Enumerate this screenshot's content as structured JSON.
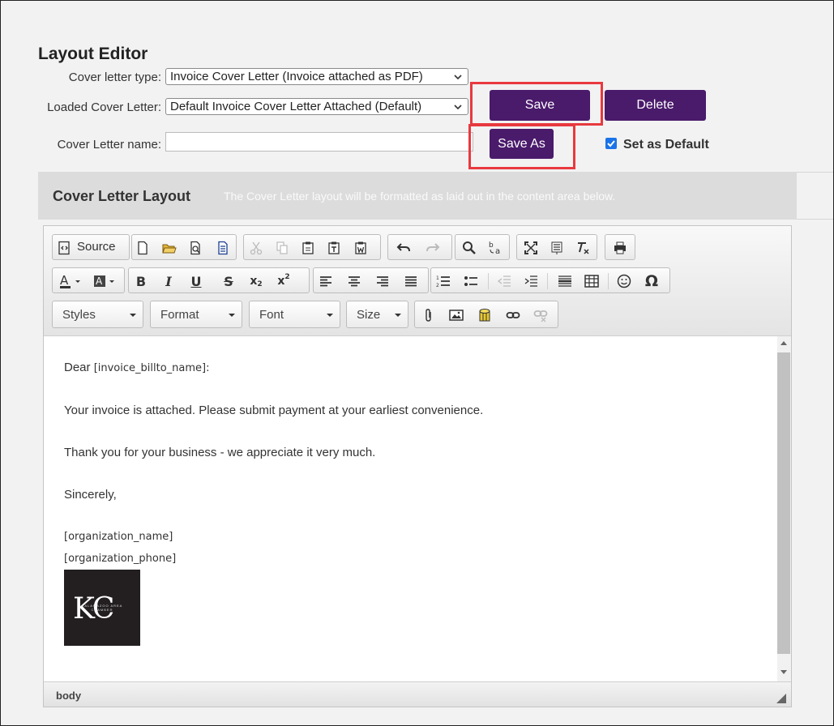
{
  "page": {
    "title": "Layout Editor",
    "cover_letter_type_label": "Cover letter type:",
    "cover_letter_type_value": "Invoice Cover Letter (Invoice attached as PDF)",
    "loaded_label": "Loaded Cover Letter:",
    "loaded_value": "Default Invoice Cover Letter Attached (Default)",
    "name_label": "Cover Letter name:",
    "name_value": "",
    "save_label": "Save",
    "delete_label": "Delete",
    "save_as_label": "Save As",
    "set_default_label": "Set as Default",
    "set_default_checked": true
  },
  "section": {
    "title": "Cover Letter Layout",
    "description": "The Cover Letter layout will be formatted as laid out in the content area below."
  },
  "toolbar": {
    "source_label": "Source",
    "styles_label": "Styles",
    "format_label": "Format",
    "font_label": "Font",
    "size_label": "Size"
  },
  "content": {
    "greeting_prefix": "Dear ",
    "greeting_token": "[invoice_billto_name]",
    "greeting_suffix": ":",
    "line1": "Your invoice is attached. Please submit payment at your earliest convenience.",
    "line2": "Thank you for your business - we appreciate it very much.",
    "line3": "Sincerely,",
    "org_name_token": "[organization_name]",
    "org_phone_token": "[organization_phone]",
    "logo_text": "KC",
    "logo_subtext": "KALAMAZOO AREA CHAMBER"
  },
  "status": {
    "path": "body"
  },
  "colors": {
    "button": "#4a1a6b",
    "highlight": "#e8393f",
    "checkbox": "#1a73e8"
  }
}
